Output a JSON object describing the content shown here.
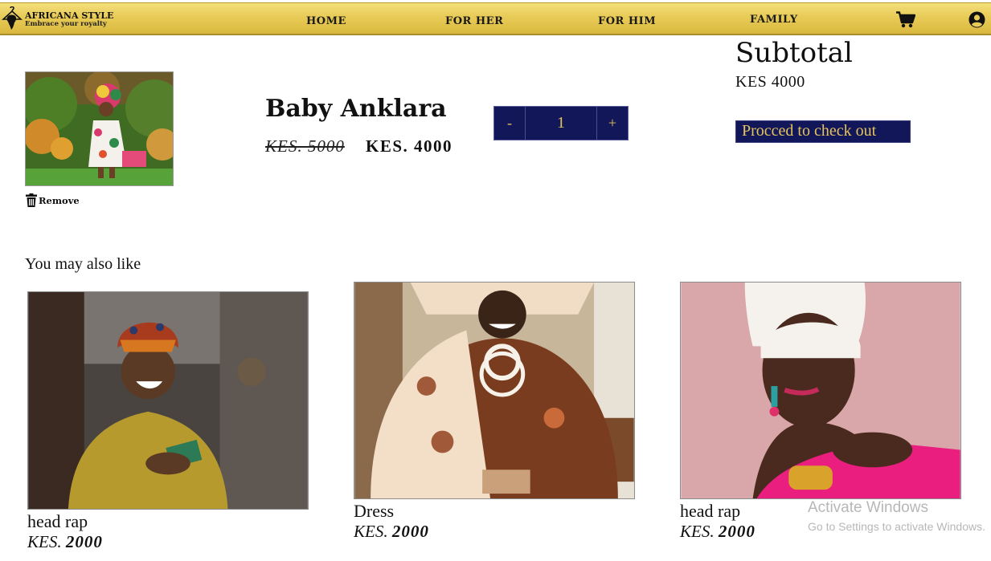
{
  "nav": {
    "brand_name": "AFRICANA STYLE",
    "brand_tagline": "Embrace your royalty",
    "links": [
      "HOME",
      "FOR HER",
      "FOR HIM",
      "FAMILY"
    ],
    "cart_icon": "cart-icon",
    "account_icon": "account-icon"
  },
  "cart": {
    "item": {
      "name": "Baby Anklara",
      "old_price": "KES. 5000",
      "price": "KES. 4000",
      "remove_label": "Remove",
      "quantity": "1",
      "decrement_label": "-",
      "increment_label": "+"
    }
  },
  "summary": {
    "title": "Subtotal",
    "value": "KES 4000",
    "checkout_label": "Procced to check out"
  },
  "recommendations": {
    "heading": "You may also like",
    "items": [
      {
        "name": "head rap",
        "currency": "KES.",
        "amount": "2000"
      },
      {
        "name": "Dress",
        "currency": "KES.",
        "amount": "2000"
      },
      {
        "name": "head rap",
        "currency": "KES.",
        "amount": "2000"
      }
    ]
  },
  "watermark": {
    "title": "Activate Windows",
    "subtitle": "Go to Settings to activate Windows."
  },
  "colors": {
    "nav_gold": "#e8cb57",
    "button_navy": "#12175a",
    "button_text_gold": "#e5c35a"
  }
}
